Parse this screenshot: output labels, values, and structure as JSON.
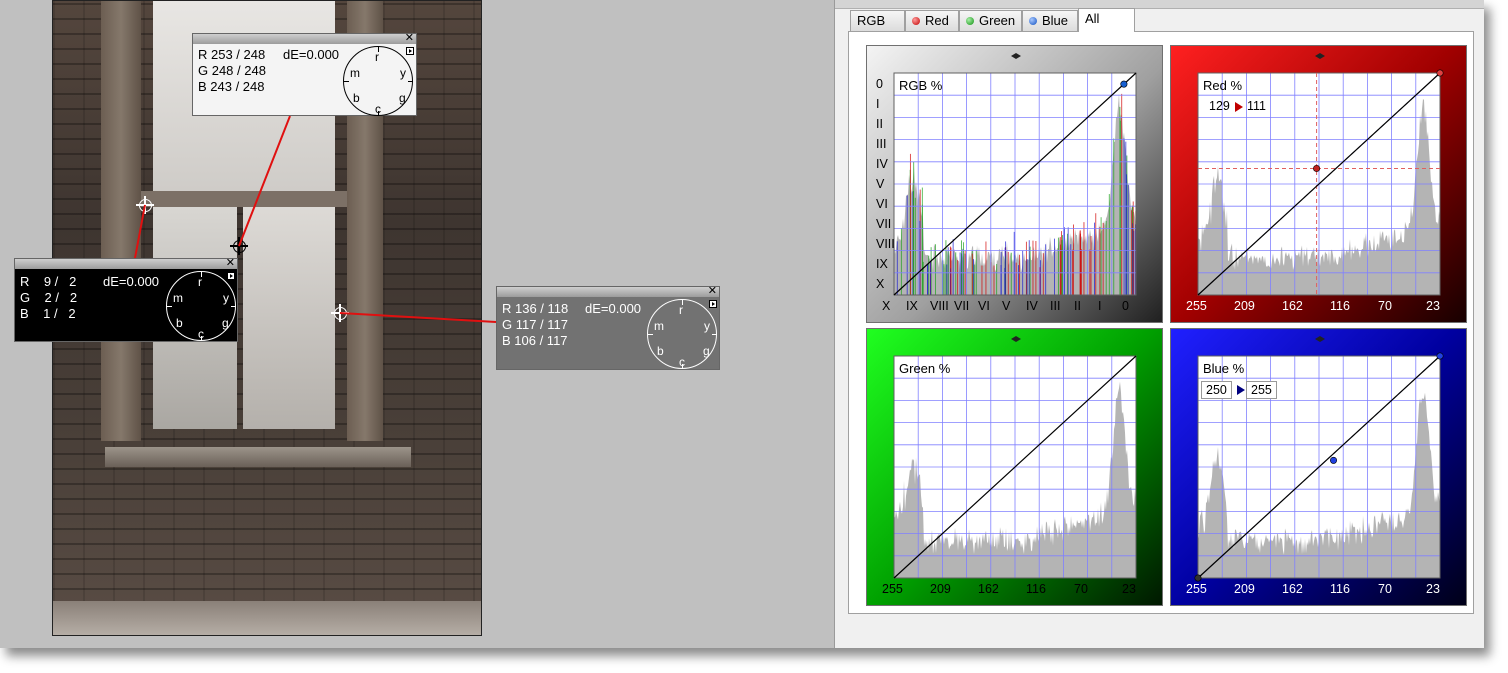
{
  "colors": {
    "red": "#d00000",
    "green": "#18a018",
    "blue": "#1818d0",
    "curve": "#000000",
    "histogram": "#b4b4b4",
    "grid": "#8080ff",
    "leader": "#e01010"
  },
  "samplers": [
    {
      "id": "sampler-1",
      "style": "light",
      "r": "R 253 / 248",
      "g": "G 248 / 248",
      "b": "B 243 / 248",
      "de": "dE=0.000"
    },
    {
      "id": "sampler-2",
      "style": "black",
      "r": "R    9 /   2",
      "g": "G    2 /   2",
      "b": "B    1 /   2",
      "de": "dE=0.000"
    },
    {
      "id": "sampler-3",
      "style": "gray",
      "r": "R 136 / 118",
      "g": "G 117 / 117",
      "b": "B 106 / 117",
      "de": "dE=0.000"
    }
  ],
  "wheel_labels": {
    "m": "m",
    "r": "r",
    "y": "y",
    "b": "b",
    "c": "c",
    "g": "g"
  },
  "window_controls": {
    "close_glyph": "✕"
  },
  "tabs": [
    {
      "label": "RGB",
      "icon": "none",
      "active": false
    },
    {
      "label": "Red",
      "icon": "red-dot-icon",
      "active": false
    },
    {
      "label": "Green",
      "icon": "green-dot-icon",
      "active": false
    },
    {
      "label": "Blue",
      "icon": "blue-dot-icon",
      "active": false
    },
    {
      "label": "All",
      "icon": "none",
      "active": true
    }
  ],
  "charts": {
    "rgb": {
      "label": "RGB %",
      "y_ticks": [
        "0",
        "I",
        "II",
        "III",
        "IV",
        "V",
        "VI",
        "VII",
        "VIII",
        "IX",
        "X"
      ],
      "x_ticks": [
        "X",
        "IX",
        "VIII",
        "VII",
        "VI",
        "V",
        "IV",
        "III",
        "II",
        "I",
        "0"
      ]
    },
    "red": {
      "label": "Red %",
      "x_ticks": [
        "255",
        "209",
        "162",
        "116",
        "70",
        "23"
      ],
      "readout_in": "129",
      "readout_out": "111"
    },
    "green": {
      "label": "Green %",
      "x_ticks": [
        "255",
        "209",
        "162",
        "116",
        "70",
        "23"
      ]
    },
    "blue": {
      "label": "Blue %",
      "x_ticks": [
        "255",
        "209",
        "162",
        "116",
        "70",
        "23"
      ],
      "readout_in": "250",
      "readout_out": "255"
    }
  },
  "chart_data": [
    {
      "type": "area",
      "name": "RGB histogram and curve",
      "title": "RGB %",
      "x": [
        "X",
        "IX",
        "VIII",
        "VII",
        "VI",
        "V",
        "IV",
        "III",
        "II",
        "I",
        "0"
      ],
      "curve": [
        [
          0,
          0
        ],
        [
          100,
          100
        ]
      ],
      "grid": true
    },
    {
      "type": "area",
      "name": "Red histogram and curve",
      "title": "Red %",
      "x": [
        "255",
        "209",
        "162",
        "116",
        "70",
        "23"
      ],
      "curve": [
        [
          0,
          0
        ],
        [
          45,
          45
        ],
        [
          100,
          100
        ]
      ],
      "readout": {
        "in": 129,
        "out": 111
      },
      "grid": true
    },
    {
      "type": "area",
      "name": "Green histogram and curve",
      "title": "Green %",
      "x": [
        "255",
        "209",
        "162",
        "116",
        "70",
        "23"
      ],
      "curve": [
        [
          0,
          0
        ],
        [
          100,
          100
        ]
      ],
      "grid": true
    },
    {
      "type": "area",
      "name": "Blue histogram and curve",
      "title": "Blue %",
      "x": [
        "255",
        "209",
        "162",
        "116",
        "70",
        "23"
      ],
      "curve": [
        [
          0,
          0
        ],
        [
          45,
          45
        ],
        [
          100,
          100
        ]
      ],
      "readout": {
        "in": 250,
        "out": 255
      },
      "grid": true
    }
  ]
}
